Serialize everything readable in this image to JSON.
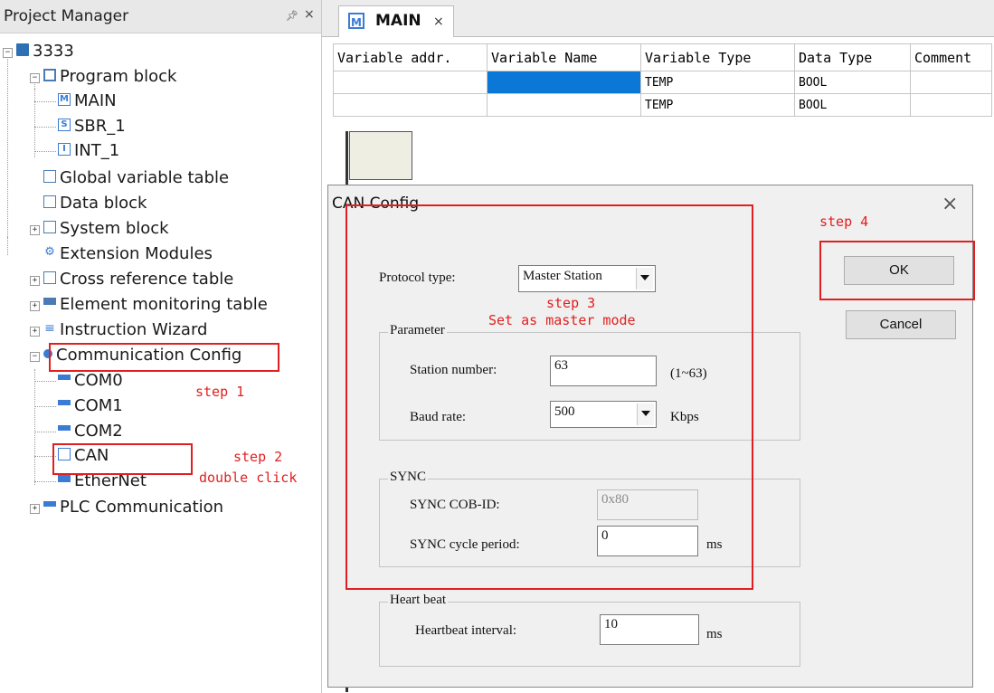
{
  "project_manager": {
    "title": "Project Manager",
    "pin_icon": "pin-icon",
    "close_glyph": "×",
    "tree": {
      "root": "3333",
      "program_block": "Program block",
      "main": "MAIN",
      "sbr": "SBR_1",
      "int": "INT_1",
      "global_var": "Global variable table",
      "data_block": "Data block",
      "system_block": "System block",
      "extension": "Extension Modules",
      "cross_ref": "Cross reference table",
      "element_monitor": "Element monitoring table",
      "instruction_wizard": "Instruction Wizard",
      "comm_config": "Communication Config",
      "com0": "COM0",
      "com1": "COM1",
      "com2": "COM2",
      "can": "CAN",
      "ethernet": "EtherNet",
      "plc_comm": "PLC Communication"
    }
  },
  "annotations": {
    "step1": "step 1",
    "step2a": "step 2",
    "step2b": "double click",
    "step3a": "step 3",
    "step3b": "Set as master mode",
    "step4": "step 4",
    "color": "#e02020"
  },
  "editor": {
    "tab_label": "MAIN",
    "tab_close": "×",
    "table": {
      "headers": [
        "Variable addr.",
        "Variable Name",
        "Variable Type",
        "Data Type",
        "Comment"
      ],
      "rows": [
        [
          "",
          "",
          "TEMP",
          "BOOL",
          ""
        ],
        [
          "",
          "",
          "TEMP",
          "BOOL",
          ""
        ]
      ]
    }
  },
  "dialog": {
    "title": "CAN Config",
    "close_glyph": "×",
    "protocol_label": "Protocol type:",
    "protocol_value": "Master Station",
    "parameter_group": "Parameter",
    "station_label": "Station number:",
    "station_value": "63",
    "station_range": "(1~63)",
    "baud_label": "Baud rate:",
    "baud_value": "500",
    "baud_unit": "Kbps",
    "sync_group": "SYNC",
    "cobid_label": "SYNC  COB-ID:",
    "cobid_value": "0x80",
    "cycle_label": "SYNC cycle period:",
    "cycle_value": "0",
    "cycle_unit": "ms",
    "heartbeat_group": "Heart beat",
    "hb_label": "Heartbeat interval:",
    "hb_value": "10",
    "hb_unit": "ms",
    "ok": "OK",
    "cancel": "Cancel"
  }
}
